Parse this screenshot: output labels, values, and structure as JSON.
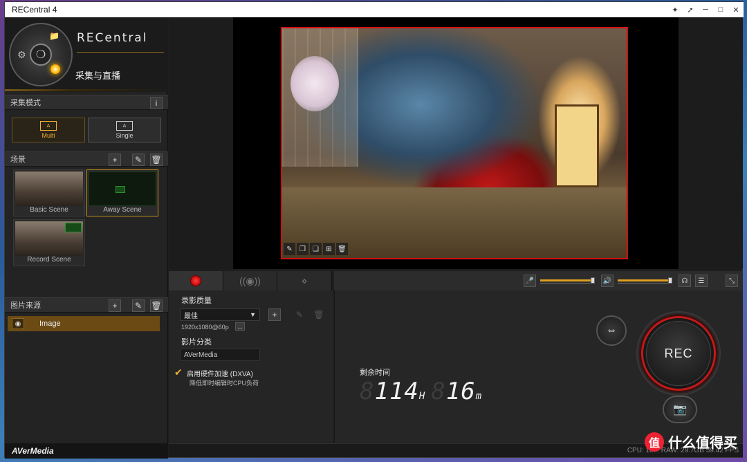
{
  "window": {
    "title": "RECentral 4",
    "controls": [
      "pin-icon",
      "pin-alt-icon",
      "minimize-icon",
      "maximize-icon",
      "close-icon"
    ]
  },
  "header": {
    "brand": "RECentral",
    "mode_title": "采集与直播"
  },
  "capture_mode": {
    "section_label": "采集模式",
    "info_button": "i",
    "modes": [
      {
        "label": "Multi",
        "icon_text": "A",
        "active": true
      },
      {
        "label": "Single",
        "icon_text": "A",
        "active": false
      }
    ]
  },
  "scenes": {
    "section_label": "场景",
    "add": "+",
    "items": [
      {
        "label": "Basic Scene",
        "active": false
      },
      {
        "label": "Away Scene",
        "active": true
      },
      {
        "label": "Record Scene",
        "active": false
      }
    ]
  },
  "image_sources": {
    "section_label": "图片来源",
    "add": "+",
    "items": [
      {
        "label": "Image",
        "visible": true
      }
    ]
  },
  "footer": {
    "brand": "AVerMedia"
  },
  "record_settings": {
    "quality_label": "录影质量",
    "quality_value": "最佳",
    "resolution_text": "1920x1080@60p",
    "more_button": "...",
    "add_button": "+",
    "category_label": "影片分类",
    "category_value": "AVerMedia",
    "hw_accel_label": "启用硬件加速 (DXVA)",
    "hw_accel_desc": "降低即时编辑时CPU负荷",
    "hw_accel_checked": true
  },
  "timer": {
    "label": "剩余时间",
    "hours": "114",
    "hours_unit": "H",
    "minutes": "16",
    "minutes_unit": "m"
  },
  "controls": {
    "rec_label": "REC"
  },
  "status": {
    "text": "CPU: 10...  RAW: 29.7GB  59.42 FPS"
  },
  "watermark": {
    "icon_text": "值",
    "text": "什么值得买"
  },
  "colors": {
    "accent": "#e0a020",
    "rec_red": "#c01a1a",
    "selection": "#6b4a14"
  }
}
